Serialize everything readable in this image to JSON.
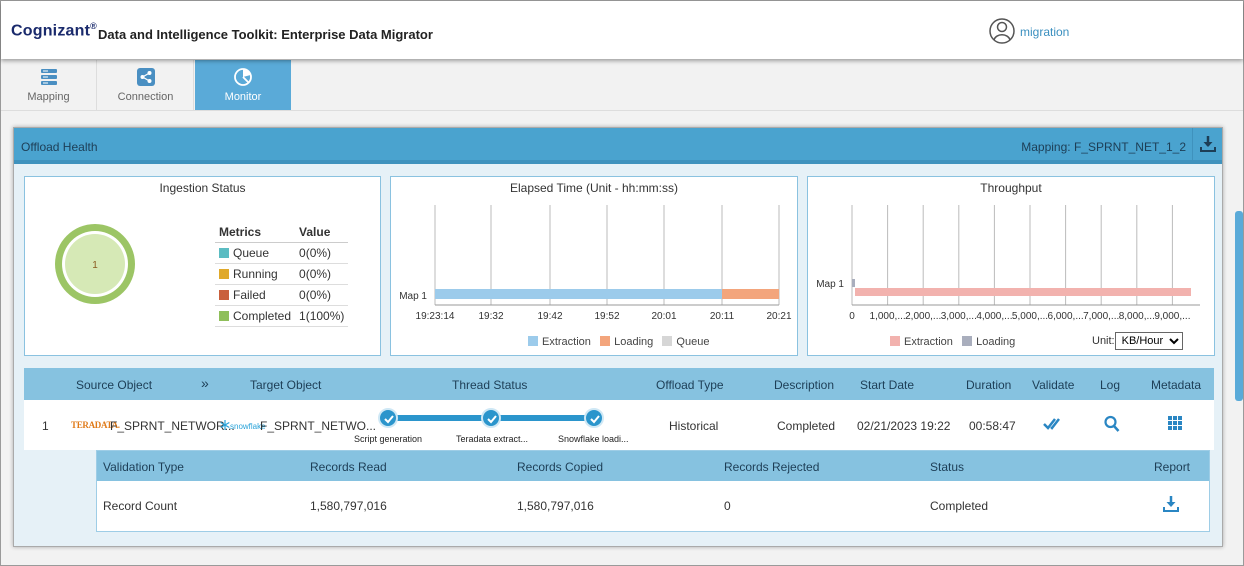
{
  "header": {
    "brand": "Cognizant",
    "brand_mark": "®",
    "app_title": "Data and Intelligence Toolkit: Enterprise Data Migrator",
    "user": "migration"
  },
  "tabs": [
    {
      "label": "Mapping",
      "icon": "server-icon",
      "active": false
    },
    {
      "label": "Connection",
      "icon": "share-icon",
      "active": false
    },
    {
      "label": "Monitor",
      "icon": "pie-chart-icon",
      "active": true
    }
  ],
  "panel": {
    "title": "Offload Health",
    "mapping_label": "Mapping: F_SPRNT_NET_1_2"
  },
  "ingestion": {
    "title": "Ingestion Status",
    "donut_value": "1",
    "columns": [
      "Metrics",
      "Value"
    ],
    "rows": [
      {
        "metric": "Queue",
        "value": "0(0%)",
        "color": "#5bbcc2"
      },
      {
        "metric": "Running",
        "value": "0(0%)",
        "color": "#e0a92a"
      },
      {
        "metric": "Failed",
        "value": "0(0%)",
        "color": "#c9603c"
      },
      {
        "metric": "Completed",
        "value": "1(100%)",
        "color": "#8fbf5a"
      }
    ]
  },
  "elapsed": {
    "title": "Elapsed Time (Unit - hh:mm:ss)",
    "row_label": "Map 1",
    "ticks": [
      "19:23:14",
      "19:32",
      "19:42",
      "19:52",
      "20:01",
      "20:11",
      "20:21"
    ],
    "legend": [
      "Extraction",
      "Loading",
      "Queue"
    ]
  },
  "throughput": {
    "title": "Throughput",
    "row_label": "Map 1",
    "ticks": [
      "0",
      "1,000,...",
      "2,000,...",
      "3,000,...",
      "4,000,...",
      "5,000,...",
      "6,000,...",
      "7,000,...",
      "8,000,...",
      "9,000,..."
    ],
    "legend": [
      "Extraction",
      "Loading"
    ],
    "unit_label": "Unit:",
    "unit_value": "KB/Hour"
  },
  "chart_data": [
    {
      "type": "bar",
      "title": "Elapsed Time (Unit - hh:mm:ss)",
      "categories": [
        "Map 1"
      ],
      "x_ticks": [
        "19:23:14",
        "19:32",
        "19:42",
        "19:52",
        "20:01",
        "20:11",
        "20:21"
      ],
      "series": [
        {
          "name": "Extraction",
          "start": "19:23:14",
          "end": "20:11",
          "color": "#9ccbeb"
        },
        {
          "name": "Loading",
          "start": "20:11",
          "end": "20:21",
          "color": "#f3a57c"
        },
        {
          "name": "Queue",
          "start": null,
          "end": null,
          "color": "#d6d6d6"
        }
      ],
      "legend": "bottom"
    },
    {
      "type": "bar",
      "title": "Throughput",
      "categories": [
        "Map 1"
      ],
      "x_ticks": [
        "0",
        "1,000,...",
        "2,000,...",
        "3,000,...",
        "4,000,...",
        "5,000,...",
        "6,000,...",
        "7,000,...",
        "8,000,...",
        "9,000,..."
      ],
      "series": [
        {
          "name": "Extraction",
          "values": [
            9800000
          ],
          "color": "#f2b2ae"
        },
        {
          "name": "Loading",
          "values": [
            0
          ],
          "color": "#a9aebd"
        }
      ],
      "xlim": [
        0,
        9800000
      ],
      "legend": "bottom"
    }
  ],
  "objects": {
    "columns": [
      "Source Object",
      "»",
      "Target Object",
      "Thread Status",
      "Offload Type",
      "Description",
      "Start Date",
      "Duration",
      "Validate",
      "Log",
      "Metadata"
    ],
    "row": {
      "index": "1",
      "source_brand": "TERADATA.",
      "source": "F_SPRNT_NETWOR...",
      "target_brand": "snowflake",
      "target": "F_SPRNT_NETWO...",
      "thread_steps": [
        "Script generation",
        "Teradata extract...",
        "Snowflake loadi..."
      ],
      "offload_type": "Historical",
      "description": "Completed",
      "start_date": "02/21/2023 19:22",
      "duration": "00:58:47"
    }
  },
  "validation": {
    "columns": [
      "Validation Type",
      "Records Read",
      "Records Copied",
      "Records Rejected",
      "Status",
      "Report"
    ],
    "row": {
      "type": "Record Count",
      "read": "1,580,797,016",
      "copied": "1,580,797,016",
      "rejected": "0",
      "status": "Completed"
    }
  }
}
